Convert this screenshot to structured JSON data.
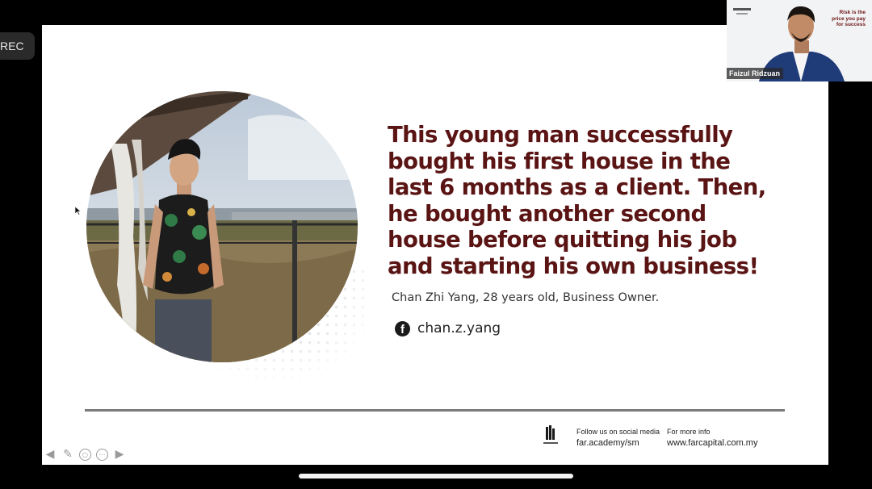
{
  "recording": {
    "label": "REC"
  },
  "slide": {
    "quote": "This young man successfully bought his first house in the last 6 months as a client. Then, he bought another second house before quitting his job and starting his own business!",
    "attribution": "Chan Zhi Yang, 28 years old, Business Owner.",
    "facebook": {
      "icon": "facebook-icon",
      "handle": "chan.z.yang"
    },
    "footer": {
      "social_label": "Follow us on social media",
      "social_link": "far.academy/sm",
      "info_label": "For more info",
      "info_link": "www.farcapital.com.my"
    }
  },
  "toolbar": {
    "icons": [
      "arrow-left-icon",
      "pen-icon",
      "view-icon",
      "more-icon",
      "arrow-right-icon"
    ]
  },
  "video_tile": {
    "participant_name": "Faizul Ridzuan",
    "poster_lines": [
      "Risk is the",
      "price you pay",
      "for success"
    ]
  },
  "colors": {
    "quote": "#5a1414",
    "slide_bg": "#ffffff",
    "screen_bg": "#000000"
  }
}
